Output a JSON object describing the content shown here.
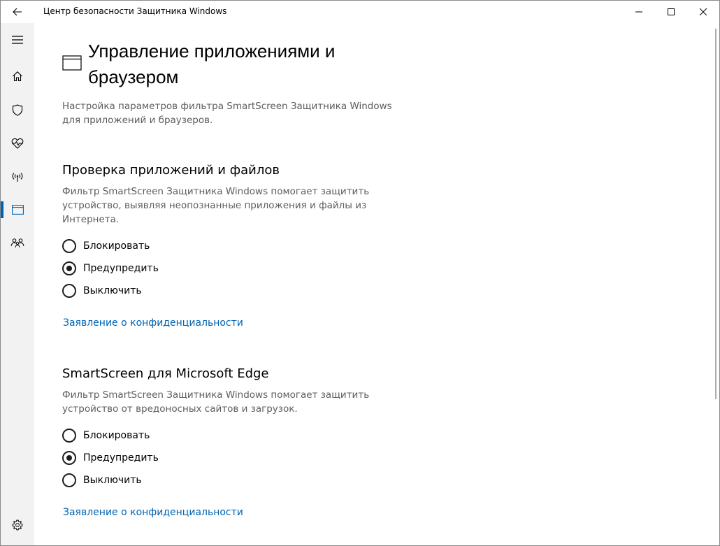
{
  "window": {
    "title": "Центр безопасности Защитника Windows"
  },
  "nav": {
    "items": [
      {
        "icon": "hamburger-menu-icon"
      },
      {
        "icon": "home-icon"
      },
      {
        "icon": "shield-icon"
      },
      {
        "icon": "heart-pulse-icon"
      },
      {
        "icon": "wireless-antenna-icon"
      },
      {
        "icon": "app-browser-icon",
        "active": true
      },
      {
        "icon": "family-icon"
      },
      {
        "icon": "settings-gear-icon"
      }
    ],
    "accent_color": "#0063b1"
  },
  "page": {
    "title": "Управление приложениями и браузером",
    "description": "Настройка параметров фильтра SmartScreen Защитника Windows для приложений и браузеров."
  },
  "sections": [
    {
      "heading": "Проверка приложений и файлов",
      "description": "Фильтр SmartScreen Защитника Windows помогает защитить устройство, выявляя неопознанные приложения и файлы из Интернета.",
      "options": [
        "Блокировать",
        "Предупредить",
        "Выключить"
      ],
      "selected": "Предупредить",
      "link": "Заявление о конфиденциальности"
    },
    {
      "heading": "SmartScreen для Microsoft Edge",
      "description": "Фильтр SmartScreen Защитника Windows помогает защитить устройство от вредоносных сайтов и загрузок.",
      "options": [
        "Блокировать",
        "Предупредить",
        "Выключить"
      ],
      "selected": "Предупредить",
      "link": "Заявление о конфиденциальности"
    }
  ],
  "colors": {
    "link": "#0063b1",
    "secondary_text": "#5d5d5d",
    "nav_background": "#f2f2f2"
  }
}
